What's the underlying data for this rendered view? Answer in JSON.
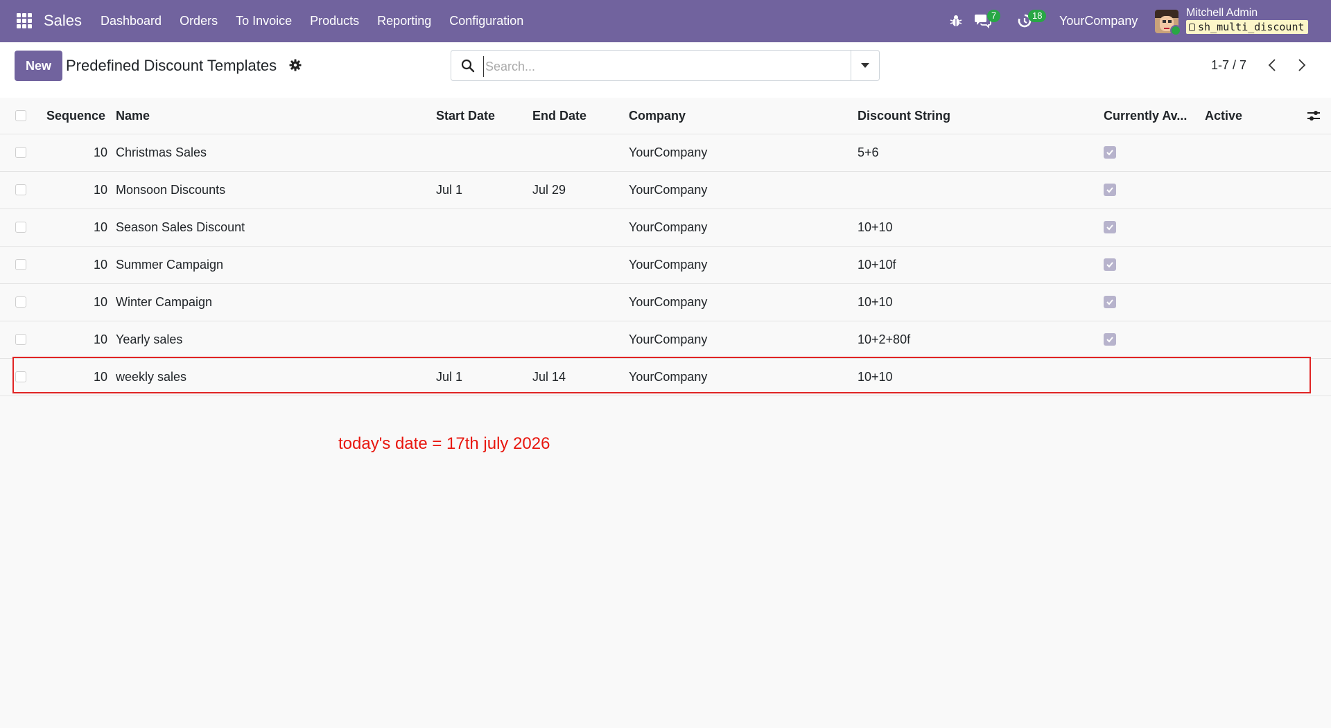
{
  "navbar": {
    "app_name": "Sales",
    "menu": [
      "Dashboard",
      "Orders",
      "To Invoice",
      "Products",
      "Reporting",
      "Configuration"
    ],
    "messages_count": "7",
    "activities_count": "18",
    "company": "YourCompany",
    "user_name": "Mitchell Admin",
    "database": "sh_multi_discount",
    "bar_color": "#71639e"
  },
  "control": {
    "new_label": "New",
    "title": "Predefined Discount Templates",
    "search_placeholder": "Search...",
    "pager": "1-7 / 7"
  },
  "table": {
    "columns": [
      "Sequence",
      "Name",
      "Start Date",
      "End Date",
      "Company",
      "Discount String",
      "Currently Av...",
      "Active"
    ],
    "rows": [
      {
        "sequence": "10",
        "name": "Christmas Sales",
        "start": "",
        "end": "",
        "company": "YourCompany",
        "discount": "5+6",
        "available": true
      },
      {
        "sequence": "10",
        "name": "Monsoon Discounts",
        "start": "Jul 1",
        "end": "Jul 29",
        "company": "YourCompany",
        "discount": "",
        "available": true
      },
      {
        "sequence": "10",
        "name": "Season Sales Discount",
        "start": "",
        "end": "",
        "company": "YourCompany",
        "discount": "10+10",
        "available": true
      },
      {
        "sequence": "10",
        "name": "Summer Campaign",
        "start": "",
        "end": "",
        "company": "YourCompany",
        "discount": "10+10f",
        "available": true
      },
      {
        "sequence": "10",
        "name": "Winter Campaign",
        "start": "",
        "end": "",
        "company": "YourCompany",
        "discount": "10+10",
        "available": true
      },
      {
        "sequence": "10",
        "name": "Yearly sales",
        "start": "",
        "end": "",
        "company": "YourCompany",
        "discount": "10+2+80f",
        "available": true
      },
      {
        "sequence": "10",
        "name": "weekly sales",
        "start": "Jul 1",
        "end": "Jul 14",
        "company": "YourCompany",
        "discount": "10+10",
        "available": false
      }
    ]
  },
  "annotation": {
    "note": "today's date = 17th july 2026",
    "color": "#e8160e"
  }
}
